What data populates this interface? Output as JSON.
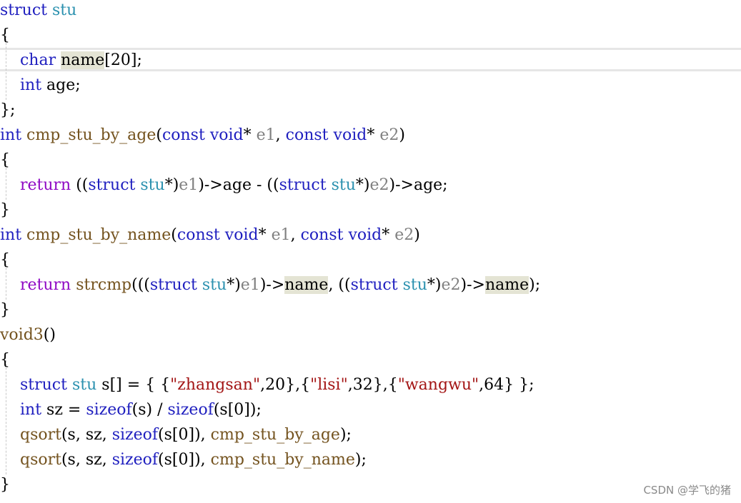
{
  "editor": {
    "lines": [
      [
        {
          "t": "struct",
          "c": "kw"
        },
        {
          "t": " "
        },
        {
          "t": "stu",
          "c": "tp"
        }
      ],
      [
        {
          "t": "{"
        }
      ],
      [
        {
          "t": "    "
        },
        {
          "t": "char",
          "c": "kw"
        },
        {
          "t": " "
        },
        {
          "t": "name",
          "c": "hl"
        },
        {
          "t": "[20];"
        }
      ],
      [
        {
          "t": "    "
        },
        {
          "t": "int",
          "c": "kw"
        },
        {
          "t": " age;"
        }
      ],
      [
        {
          "t": "};"
        }
      ],
      [
        {
          "t": "int",
          "c": "kw"
        },
        {
          "t": " "
        },
        {
          "t": "cmp_stu_by_age",
          "c": "fn"
        },
        {
          "t": "("
        },
        {
          "t": "const",
          "c": "kw"
        },
        {
          "t": " "
        },
        {
          "t": "void",
          "c": "kw"
        },
        {
          "t": "* "
        },
        {
          "t": "e1",
          "c": "pm"
        },
        {
          "t": ", "
        },
        {
          "t": "const",
          "c": "kw"
        },
        {
          "t": " "
        },
        {
          "t": "void",
          "c": "kw"
        },
        {
          "t": "* "
        },
        {
          "t": "e2",
          "c": "pm"
        },
        {
          "t": ")"
        }
      ],
      [
        {
          "t": "{"
        }
      ],
      [
        {
          "t": "    "
        },
        {
          "t": "return",
          "c": "ctl"
        },
        {
          "t": " (("
        },
        {
          "t": "struct",
          "c": "kw"
        },
        {
          "t": " "
        },
        {
          "t": "stu",
          "c": "tp"
        },
        {
          "t": "*)"
        },
        {
          "t": "e1",
          "c": "pm"
        },
        {
          "t": ")->age - (("
        },
        {
          "t": "struct",
          "c": "kw"
        },
        {
          "t": " "
        },
        {
          "t": "stu",
          "c": "tp"
        },
        {
          "t": "*)"
        },
        {
          "t": "e2",
          "c": "pm"
        },
        {
          "t": ")->age;"
        }
      ],
      [
        {
          "t": "}"
        }
      ],
      [
        {
          "t": "int",
          "c": "kw"
        },
        {
          "t": " "
        },
        {
          "t": "cmp_stu_by_name",
          "c": "fn"
        },
        {
          "t": "("
        },
        {
          "t": "const",
          "c": "kw"
        },
        {
          "t": " "
        },
        {
          "t": "void",
          "c": "kw"
        },
        {
          "t": "* "
        },
        {
          "t": "e1",
          "c": "pm"
        },
        {
          "t": ", "
        },
        {
          "t": "const",
          "c": "kw"
        },
        {
          "t": " "
        },
        {
          "t": "void",
          "c": "kw"
        },
        {
          "t": "* "
        },
        {
          "t": "e2",
          "c": "pm"
        },
        {
          "t": ")"
        }
      ],
      [
        {
          "t": "{"
        }
      ],
      [
        {
          "t": "    "
        },
        {
          "t": "return",
          "c": "ctl"
        },
        {
          "t": " "
        },
        {
          "t": "strcmp",
          "c": "fn"
        },
        {
          "t": "((("
        },
        {
          "t": "struct",
          "c": "kw"
        },
        {
          "t": " "
        },
        {
          "t": "stu",
          "c": "tp"
        },
        {
          "t": "*)"
        },
        {
          "t": "e1",
          "c": "pm"
        },
        {
          "t": ")->"
        },
        {
          "t": "name",
          "c": "hl"
        },
        {
          "t": ", (("
        },
        {
          "t": "struct",
          "c": "kw"
        },
        {
          "t": " "
        },
        {
          "t": "stu",
          "c": "tp"
        },
        {
          "t": "*)"
        },
        {
          "t": "e2",
          "c": "pm"
        },
        {
          "t": ")->"
        },
        {
          "t": "name",
          "c": "hl"
        },
        {
          "t": ");"
        }
      ],
      [
        {
          "t": "}"
        }
      ],
      [
        {
          "t": "void3",
          "c": "fn"
        },
        {
          "t": "()"
        }
      ],
      [
        {
          "t": "{"
        }
      ],
      [
        {
          "t": "    "
        },
        {
          "t": "struct",
          "c": "kw"
        },
        {
          "t": " "
        },
        {
          "t": "stu",
          "c": "tp"
        },
        {
          "t": " s[] = { {"
        },
        {
          "t": "\"zhangsan\"",
          "c": "str"
        },
        {
          "t": ",20},{"
        },
        {
          "t": "\"lisi\"",
          "c": "str"
        },
        {
          "t": ",32},{"
        },
        {
          "t": "\"wangwu\"",
          "c": "str"
        },
        {
          "t": ",64} };"
        }
      ],
      [
        {
          "t": "    "
        },
        {
          "t": "int",
          "c": "kw"
        },
        {
          "t": " sz = "
        },
        {
          "t": "sizeof",
          "c": "kw"
        },
        {
          "t": "(s) / "
        },
        {
          "t": "sizeof",
          "c": "kw"
        },
        {
          "t": "(s[0]);"
        }
      ],
      [
        {
          "t": "    "
        },
        {
          "t": "qsort",
          "c": "fn"
        },
        {
          "t": "(s, sz, "
        },
        {
          "t": "sizeof",
          "c": "kw"
        },
        {
          "t": "(s[0]), "
        },
        {
          "t": "cmp_stu_by_age",
          "c": "fn"
        },
        {
          "t": ");"
        }
      ],
      [
        {
          "t": "    "
        },
        {
          "t": "qsort",
          "c": "fn"
        },
        {
          "t": "(s, sz, "
        },
        {
          "t": "sizeof",
          "c": "kw"
        },
        {
          "t": "(s[0]), "
        },
        {
          "t": "cmp_stu_by_name",
          "c": "fn"
        },
        {
          "t": ");"
        }
      ],
      [
        {
          "t": "}"
        }
      ]
    ]
  },
  "watermark": "CSDN @学飞的猪",
  "colors": {
    "keyword": "#1f1fbf",
    "type": "#2b91af",
    "control": "#8f08c4",
    "function": "#74531f",
    "parameter": "#808080",
    "string": "#a31515",
    "highlight": "#e4e4d4"
  }
}
